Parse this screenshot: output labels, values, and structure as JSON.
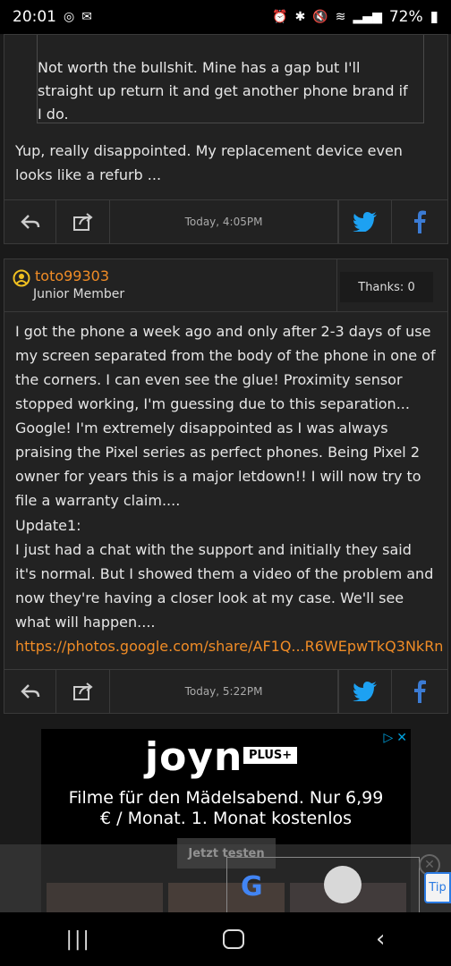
{
  "status_bar": {
    "time": "20:01",
    "battery": "72%"
  },
  "post1": {
    "quote": "Not worth the bullshit. Mine has a gap but I'll straight up return it and get another phone brand if I do.",
    "body": "Yup, really disappointed. My replacement device even looks like a refurb ...",
    "timestamp": "Today, 4:05PM"
  },
  "post2": {
    "username": "toto99303",
    "role": "Junior Member",
    "thanks": "Thanks: 0",
    "body": "I got the phone a week ago and only after 2-3 days of use my screen separated from the body of the phone in one of the corners. I can even see the glue! Proximity sensor stopped working, I'm guessing due to this separation... Google! I'm extremely disappointed as I was always praising the Pixel series as perfect phones. Being Pixel 2 owner for years this is a major letdown!! I will now try to file a warranty claim....",
    "update_label": "Update1:",
    "update_body": "I just had a chat with the support and initially they said it's normal. But I showed them a video of the problem and now they're having a closer look at my case. We'll see what will happen....",
    "link": "https://photos.google.com/share/AF1Q...R6WEpwTkQ3NkRn",
    "timestamp": "Today, 5:22PM"
  },
  "ad": {
    "brand": "joyn",
    "badge": "PLUS+",
    "headline": "Filme für den Mädelsabend. Nur 6,99 € / Monat. 1. Monat kostenlos",
    "cta": "Jetzt testen",
    "side_label": "Tip"
  }
}
